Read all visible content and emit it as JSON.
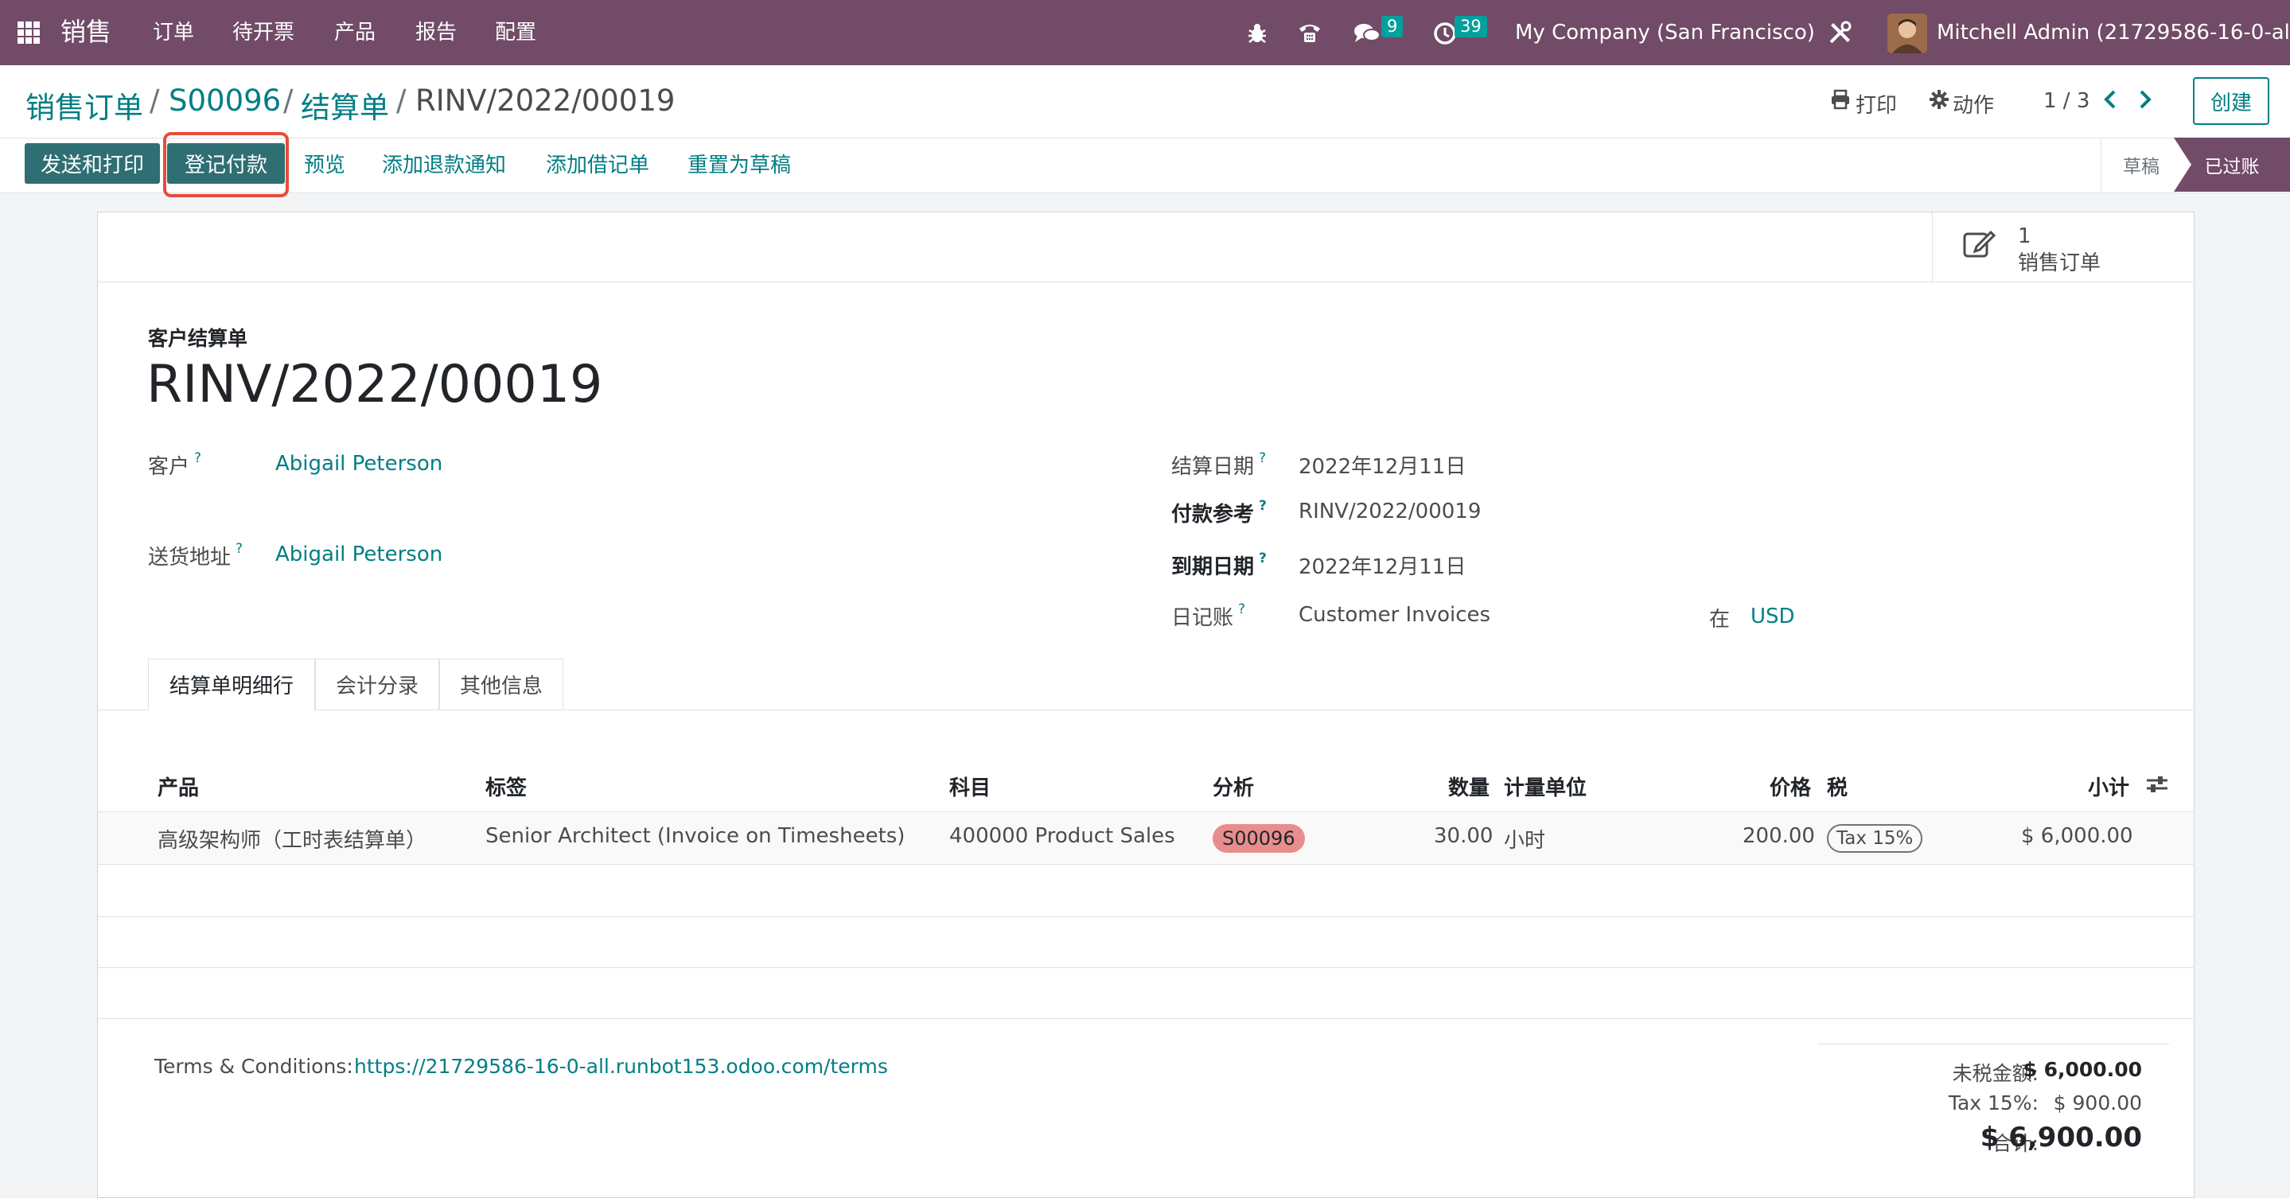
{
  "navbar": {
    "app_name": "销售",
    "menu": [
      "订单",
      "待开票",
      "产品",
      "报告",
      "配置"
    ],
    "messages_count": "9",
    "activities_count": "39",
    "company": "My Company (San Francisco)",
    "user": "Mitchell Admin (21729586-16-0-all)",
    "color": "#714b67"
  },
  "breadcrumb": {
    "items": [
      "销售订单",
      "S00096",
      "结算单"
    ],
    "current": "RINV/2022/00019"
  },
  "control_panel": {
    "print_label": "打印",
    "action_label": "动作",
    "pager": "1 / 3",
    "create_label": "创建"
  },
  "status_bar": {
    "buttons": [
      "发送和打印",
      "登记付款",
      "预览",
      "添加退款通知",
      "添加借记单",
      "重置为草稿"
    ],
    "stages": [
      "草稿",
      "已过账"
    ],
    "active_stage": "已过账"
  },
  "smart_button": {
    "count": "1",
    "label": "销售订单"
  },
  "form": {
    "doc_type": "客户结算单",
    "doc_name": "RINV/2022/00019",
    "customer_label": "客户",
    "customer": "Abigail Peterson",
    "delivery_label": "送货地址",
    "delivery": "Abigail Peterson",
    "invoice_date_label": "结算日期",
    "invoice_date": "2022年12月11日",
    "payment_ref_label": "付款参考",
    "payment_ref": "RINV/2022/00019",
    "due_date_label": "到期日期",
    "due_date": "2022年12月11日",
    "journal_label": "日记账",
    "journal": "Customer Invoices",
    "currency_in": "在",
    "currency": "USD",
    "help_mark": "?"
  },
  "tabs": [
    "结算单明细行",
    "会计分录",
    "其他信息"
  ],
  "lines": {
    "headers": [
      "产品",
      "标签",
      "科目",
      "分析",
      "数量",
      "计量单位",
      "价格",
      "税",
      "小计"
    ],
    "rows": [
      {
        "product": "高级架构师（工时表结算单）",
        "label": "Senior Architect (Invoice on Timesheets)",
        "account": "400000 Product Sales",
        "analytic": "S00096",
        "quantity": "30.00",
        "uom": "小时",
        "price": "200.00",
        "tax": "Tax 15%",
        "subtotal": "$ 6,000.00"
      }
    ]
  },
  "footer": {
    "terms_label": "Terms & Conditions:",
    "terms_link": "https://21729586-16-0-all.runbot153.odoo.com/terms",
    "untaxed_label": "未税金额:",
    "untaxed": "$ 6,000.00",
    "tax_label": "Tax 15%:",
    "tax": "$ 900.00",
    "total_label": "合计:",
    "total": "$ 6,900.00"
  }
}
